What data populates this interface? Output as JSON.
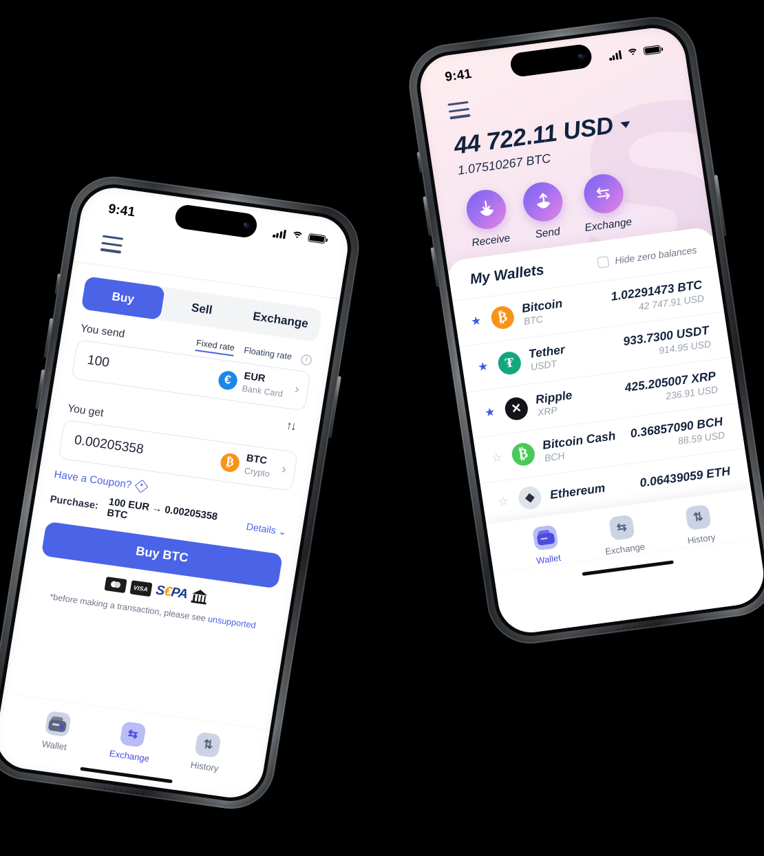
{
  "scene": {
    "background_color": "#000000",
    "left_phone_screen": "buy-exchange",
    "right_phone_screen": "my-wallets"
  },
  "left_phone": {
    "status_bar": {
      "time": "9:41",
      "signal_icon": "cellular-bars-icon",
      "wifi_icon": "wifi-icon",
      "battery_icon": "battery-icon"
    },
    "menu_icon": "hamburger-menu-icon",
    "tabs": [
      {
        "label": "Buy",
        "active": true
      },
      {
        "label": "Sell",
        "active": false
      },
      {
        "label": "Exchange",
        "active": false
      }
    ],
    "you_send": {
      "label": "You send",
      "value": "100",
      "currency_code": "EUR",
      "currency_sub": "Bank Card",
      "currency_symbol": "€",
      "chevron": "›"
    },
    "rate_modes": [
      {
        "label": "Fixed rate",
        "active": true
      },
      {
        "label": "Floating rate",
        "active": false
      }
    ],
    "info_icon": "info-circle-icon",
    "swap_icon": "swap-vertical-icon",
    "swap_glyph": "↑↓",
    "you_get": {
      "label": "You get",
      "value": "0.00205358",
      "currency_code": "BTC",
      "currency_sub": "Crypto",
      "currency_symbol": "₿",
      "chevron": "›"
    },
    "coupon": {
      "label": "Have a Coupon?",
      "icon": "coupon-tag-icon"
    },
    "purchase": {
      "label": "Purchase:",
      "value": "100 EUR → 0.00205358 BTC",
      "details_label": "Details",
      "details_chevron": "⌄"
    },
    "cta_button": "Buy BTC",
    "payment_methods": [
      {
        "name": "mastercard-icon",
        "label": ""
      },
      {
        "name": "visa-icon",
        "label": "VISA"
      },
      {
        "name": "sepa-icon",
        "label_pre": "S",
        "label_eu": "€",
        "label_post": "PA"
      },
      {
        "name": "bank-transfer-icon",
        "label": ""
      }
    ],
    "disclaimer": {
      "text": "*before making a transaction, please see ",
      "link": "unsupported"
    },
    "bottom_nav": [
      {
        "label": "Wallet",
        "icon": "wallet-icon",
        "active": false
      },
      {
        "label": "Exchange",
        "icon": "exchange-icon",
        "glyph": "⇆",
        "active": true
      },
      {
        "label": "History",
        "icon": "history-icon",
        "glyph": "⇅",
        "active": false
      }
    ]
  },
  "right_phone": {
    "status_bar": {
      "time": "9:41",
      "signal_icon": "cellular-bars-icon",
      "wifi_icon": "wifi-icon",
      "battery_icon": "battery-icon"
    },
    "menu_icon": "hamburger-menu-icon",
    "watermark_letter": "S",
    "balance": {
      "fiat": "44 722.11 USD",
      "crypto": "1.07510267 BTC",
      "dropdown_icon": "chevron-down-icon"
    },
    "actions": [
      {
        "label": "Receive",
        "icon": "receive-arrow-down-icon",
        "glyph": "↓"
      },
      {
        "label": "Send",
        "icon": "send-arrow-up-icon",
        "glyph": "↑"
      },
      {
        "label": "Exchange",
        "icon": "exchange-arrows-icon",
        "glyph": "⇄"
      }
    ],
    "wallets_header": {
      "title": "My Wallets",
      "hide_zero_label": "Hide zero balances",
      "hide_zero_checked": false,
      "checkbox_icon": "checkbox-unchecked-icon"
    },
    "wallets": [
      {
        "name": "Bitcoin",
        "ticker": "BTC",
        "amount": "1.02291473 BTC",
        "fiat": "42 747.91 USD",
        "favorite": true,
        "symbol": "₿",
        "icon_class": "btc",
        "color": "#f7931a"
      },
      {
        "name": "Tether",
        "ticker": "USDT",
        "amount": "933.7300 USDT",
        "fiat": "914.95 USD",
        "favorite": true,
        "symbol": "₮",
        "icon_class": "usdt",
        "color": "#14a67f"
      },
      {
        "name": "Ripple",
        "ticker": "XRP",
        "amount": "425.205007 XRP",
        "fiat": "236.91 USD",
        "favorite": true,
        "symbol": "✕",
        "icon_class": "xrp",
        "color": "#14151a"
      },
      {
        "name": "Bitcoin Cash",
        "ticker": "BCH",
        "amount": "0.36857090 BCH",
        "fiat": "88.59 USD",
        "favorite": false,
        "symbol": "₿",
        "icon_class": "bch",
        "color": "#49c95c"
      },
      {
        "name": "Ethereum",
        "ticker": "ETH",
        "amount": "0.06439059 ETH",
        "fiat": "",
        "favorite": false,
        "symbol": "◆",
        "icon_class": "eth",
        "color": "#dfe3ea"
      }
    ],
    "bottom_nav": [
      {
        "label": "Wallet",
        "icon": "wallet-icon",
        "active": true
      },
      {
        "label": "Exchange",
        "icon": "exchange-icon",
        "glyph": "⇆",
        "active": false
      },
      {
        "label": "History",
        "icon": "history-icon",
        "glyph": "⇅",
        "active": false
      }
    ]
  },
  "colors": {
    "primary_blue": "#4a63e7",
    "dark_navy": "#13233d",
    "muted_gray": "#9aa1ad",
    "gradient_purple_start": "#7a64ee",
    "gradient_pink_end": "#d98ae4",
    "header_pink": "#fdeef0"
  }
}
